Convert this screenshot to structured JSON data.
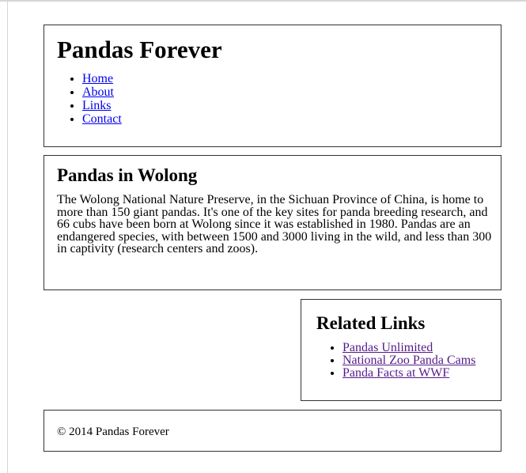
{
  "header": {
    "title": "Pandas Forever",
    "nav": [
      "Home",
      "About",
      "Links",
      "Contact"
    ]
  },
  "main": {
    "heading": "Pandas in Wolong",
    "text": "The Wolong National Nature Preserve, in the Sichuan Province of China, is home to more than 150 giant pandas. It's one of the key sites for panda breeding research, and 66 cubs have been born at Wolong since it was established in 1980. Pandas are an endangered species, with between 1500 and 3000 living in the wild, and less than 300 in captivity (research centers and zoos)."
  },
  "related": {
    "heading": "Related Links",
    "links": [
      "Pandas Unlimited",
      "National Zoo Panda Cams",
      "Panda Facts at WWF"
    ]
  },
  "footer": {
    "text": "© 2014 Pandas Forever"
  },
  "colors": {
    "link": "#0000ee",
    "visited_link": "#551a8b",
    "border": "#333333"
  }
}
